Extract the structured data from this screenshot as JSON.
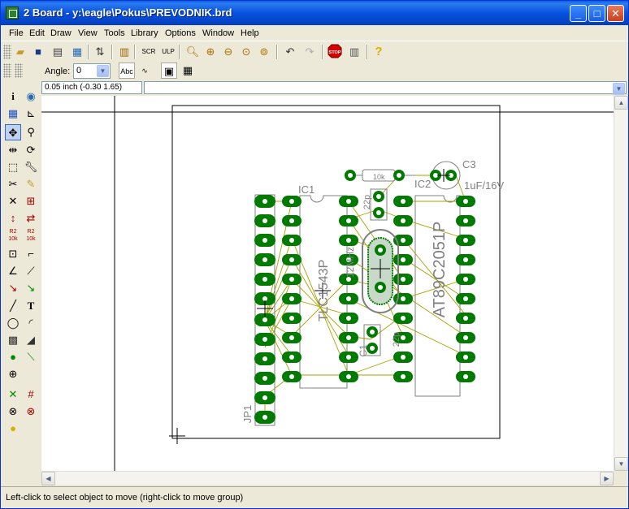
{
  "window": {
    "title": "2 Board - y:\\eagle\\Pokus\\PREVODNIK.brd",
    "minimize": "_",
    "maximize": "□",
    "close": "✕"
  },
  "menu": [
    "File",
    "Edit",
    "Draw",
    "View",
    "Tools",
    "Library",
    "Options",
    "Window",
    "Help"
  ],
  "parambar": {
    "angle_label": "Angle:",
    "angle_value": "0"
  },
  "coords": "0.05 inch (-0.30 1.65)",
  "command_value": "",
  "board": {
    "parts": {
      "ic1": "IC1",
      "ic1_value": "TLC1543P",
      "ic2": "IC2",
      "ic2_value": "AT89C2051P",
      "c3": "C3",
      "c3_value": "1uF/16V",
      "r_value": "10k",
      "c1": "C1",
      "c1_value": "22p",
      "c2_value": "22p",
      "q_value": "12MHz",
      "jp1": "JP1"
    }
  },
  "status": "Left-click to select object to move (right-click to move group)",
  "colors": {
    "pad": "#007a00",
    "airwire": "#a8a000",
    "outline": "#000000",
    "silk": "#808080"
  }
}
